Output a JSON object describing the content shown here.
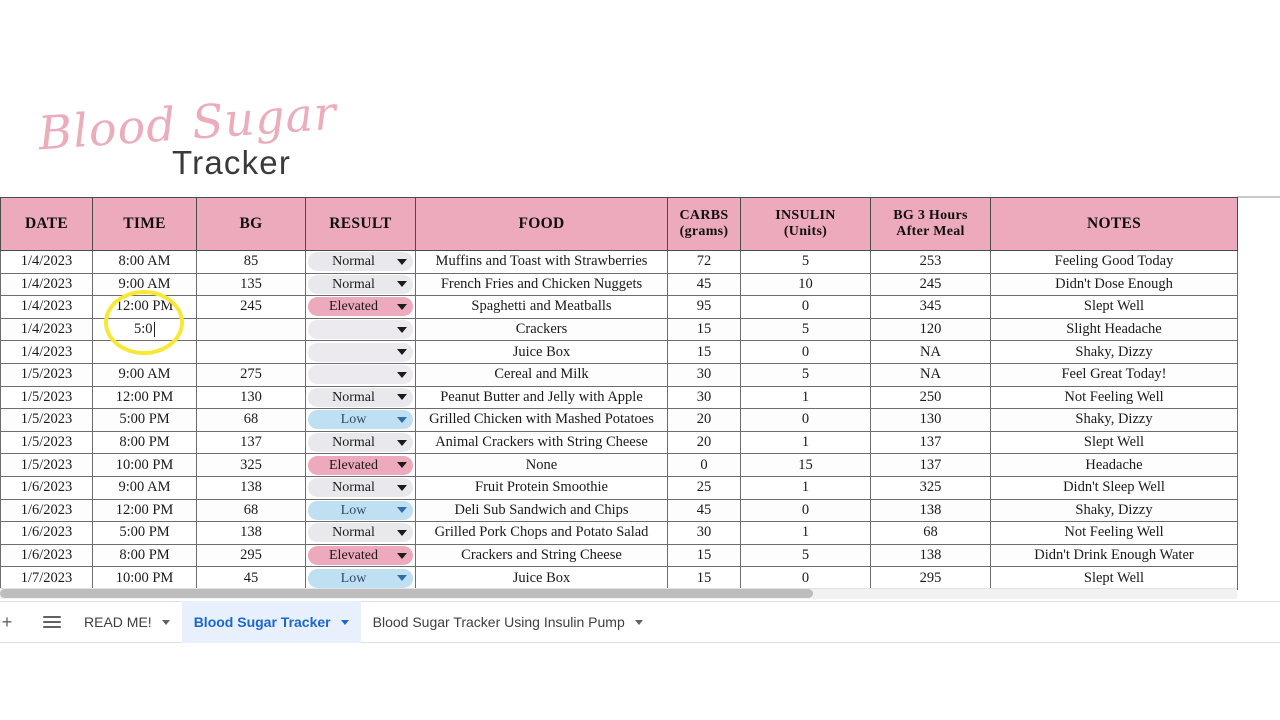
{
  "logo": {
    "script_text": "Blood Sugar",
    "sub_text": "Tracker",
    "script_color": "#eaa9b8",
    "sub_color": "#3a3a3a"
  },
  "table": {
    "header_bg": "#edaabc",
    "columns": [
      {
        "key": "date",
        "label": "DATE",
        "sub": ""
      },
      {
        "key": "time",
        "label": "TIME",
        "sub": ""
      },
      {
        "key": "bg",
        "label": "BG",
        "sub": ""
      },
      {
        "key": "result",
        "label": "RESULT",
        "sub": ""
      },
      {
        "key": "food",
        "label": "FOOD",
        "sub": ""
      },
      {
        "key": "carbs",
        "label": "CARBS",
        "sub": "(grams)"
      },
      {
        "key": "insulin",
        "label": "INSULIN",
        "sub": "(Units)"
      },
      {
        "key": "bg3",
        "label": "BG 3 Hours",
        "sub": "After Meal"
      },
      {
        "key": "notes",
        "label": "NOTES",
        "sub": ""
      }
    ],
    "rows": [
      {
        "date": "1/4/2023",
        "time": "8:00 AM",
        "bg": "85",
        "result": "Normal",
        "result_style": "normal",
        "food": "Muffins and Toast with Strawberries",
        "carbs": "72",
        "insulin": "5",
        "bg3": "253",
        "notes": "Feeling Good Today"
      },
      {
        "date": "1/4/2023",
        "time": "9:00 AM",
        "bg": "135",
        "result": "Normal",
        "result_style": "normal",
        "food": "French Fries and Chicken Nuggets",
        "carbs": "45",
        "insulin": "10",
        "bg3": "245",
        "notes": "Didn't Dose Enough"
      },
      {
        "date": "1/4/2023",
        "time": "12:00 PM",
        "bg": "245",
        "result": "Elevated",
        "result_style": "elevated",
        "food": "Spaghetti and Meatballs",
        "carbs": "95",
        "insulin": "0",
        "bg3": "345",
        "notes": "Slept Well"
      },
      {
        "date": "1/4/2023",
        "time": "",
        "bg": "",
        "result": "",
        "result_style": "blank",
        "food": "Crackers",
        "carbs": "15",
        "insulin": "5",
        "bg3": "120",
        "notes": "Slight Headache",
        "editing": true,
        "edit_value": "5:0"
      },
      {
        "date": "1/4/2023",
        "time": "",
        "bg": "",
        "result": "",
        "result_style": "blank",
        "food": "Juice Box",
        "carbs": "15",
        "insulin": "0",
        "bg3": "NA",
        "notes": "Shaky, Dizzy"
      },
      {
        "date": "1/5/2023",
        "time": "9:00 AM",
        "bg": "275",
        "result": "",
        "result_style": "blank",
        "food": "Cereal and Milk",
        "carbs": "30",
        "insulin": "5",
        "bg3": "NA",
        "notes": "Feel Great Today!"
      },
      {
        "date": "1/5/2023",
        "time": "12:00 PM",
        "bg": "130",
        "result": "Normal",
        "result_style": "normal",
        "food": "Peanut Butter and Jelly with Apple",
        "carbs": "30",
        "insulin": "1",
        "bg3": "250",
        "notes": "Not Feeling Well"
      },
      {
        "date": "1/5/2023",
        "time": "5:00 PM",
        "bg": "68",
        "result": "Low",
        "result_style": "low",
        "food": "Grilled Chicken with Mashed Potatoes",
        "carbs": "20",
        "insulin": "0",
        "bg3": "130",
        "notes": "Shaky, Dizzy"
      },
      {
        "date": "1/5/2023",
        "time": "8:00 PM",
        "bg": "137",
        "result": "Normal",
        "result_style": "normal",
        "food": "Animal Crackers with String Cheese",
        "carbs": "20",
        "insulin": "1",
        "bg3": "137",
        "notes": "Slept Well"
      },
      {
        "date": "1/5/2023",
        "time": "10:00 PM",
        "bg": "325",
        "result": "Elevated",
        "result_style": "elevated",
        "food": "None",
        "carbs": "0",
        "insulin": "15",
        "bg3": "137",
        "notes": "Headache"
      },
      {
        "date": "1/6/2023",
        "time": "9:00 AM",
        "bg": "138",
        "result": "Normal",
        "result_style": "normal",
        "food": "Fruit Protein Smoothie",
        "carbs": "25",
        "insulin": "1",
        "bg3": "325",
        "notes": "Didn't Sleep Well"
      },
      {
        "date": "1/6/2023",
        "time": "12:00 PM",
        "bg": "68",
        "result": "Low",
        "result_style": "low",
        "food": "Deli Sub Sandwich and Chips",
        "carbs": "45",
        "insulin": "0",
        "bg3": "138",
        "notes": "Shaky, Dizzy"
      },
      {
        "date": "1/6/2023",
        "time": "5:00 PM",
        "bg": "138",
        "result": "Normal",
        "result_style": "normal",
        "food": "Grilled Pork Chops and Potato Salad",
        "carbs": "30",
        "insulin": "1",
        "bg3": "68",
        "notes": "Not Feeling Well"
      },
      {
        "date": "1/6/2023",
        "time": "8:00 PM",
        "bg": "295",
        "result": "Elevated",
        "result_style": "elevated",
        "food": "Crackers and String Cheese",
        "carbs": "15",
        "insulin": "5",
        "bg3": "138",
        "notes": "Didn't Drink Enough Water"
      },
      {
        "date": "1/7/2023",
        "time": "10:00 PM",
        "bg": "45",
        "result": "Low",
        "result_style": "low",
        "food": "Juice Box",
        "carbs": "15",
        "insulin": "0",
        "bg3": "295",
        "notes": "Slept Well"
      }
    ]
  },
  "tabbar": {
    "all_sheets_icon": "hamburger-icon",
    "tabs": [
      {
        "label": "READ ME!",
        "active": false
      },
      {
        "label": "Blood Sugar Tracker",
        "active": true
      },
      {
        "label": "Blood Sugar Tracker Using Insulin Pump",
        "active": false
      }
    ],
    "active_color": "#1967d2",
    "active_bg": "#e8f0fe"
  },
  "annotation": {
    "type": "circle-highlight",
    "color": "#f7e836"
  }
}
